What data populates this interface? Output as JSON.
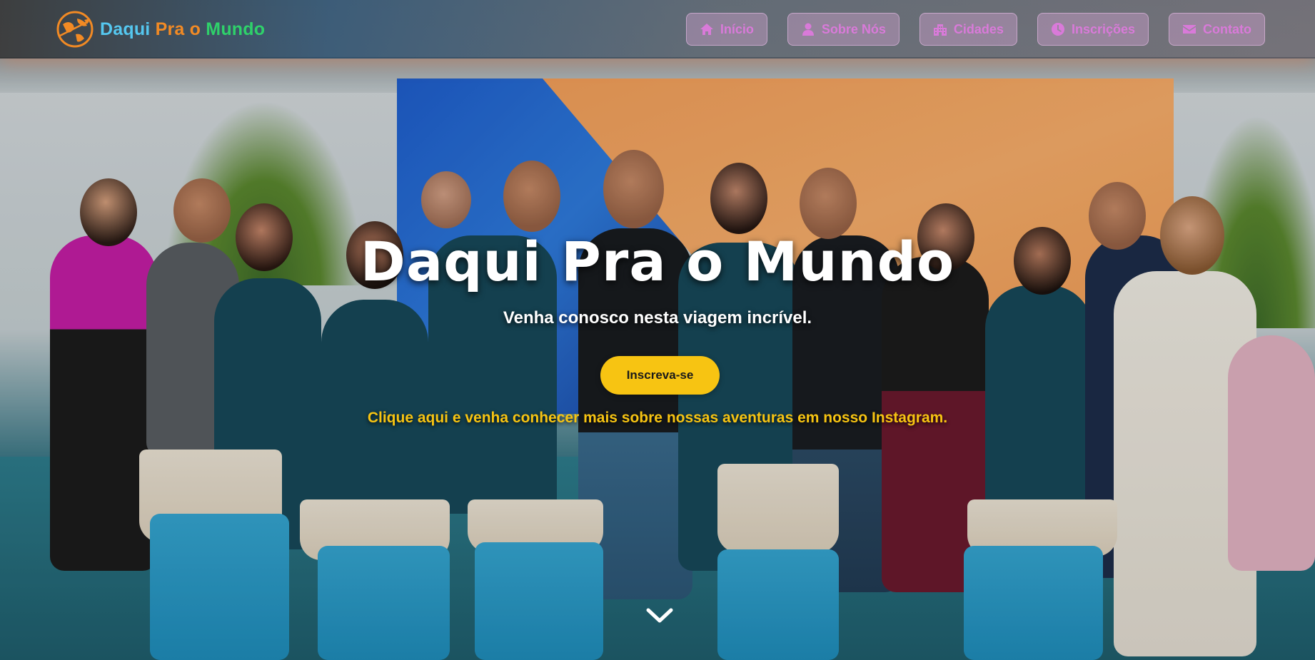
{
  "brand": {
    "part1": "Daqui",
    "part2": "Pra o",
    "part3": "Mundo",
    "logo_icon": "globe-plane-icon"
  },
  "nav": {
    "items": [
      {
        "label": "Início",
        "icon": "home-icon"
      },
      {
        "label": "Sobre Nós",
        "icon": "user-icon"
      },
      {
        "label": "Cidades",
        "icon": "city-icon"
      },
      {
        "label": "Inscrições",
        "icon": "clock-icon"
      },
      {
        "label": "Contato",
        "icon": "envelope-icon"
      }
    ]
  },
  "hero": {
    "title": "Daqui Pra o Mundo",
    "subtitle": "Venha conosco nesta viagem incrível.",
    "cta_label": "Inscreva-se",
    "instagram_text": "Clique aqui e venha conhecer mais sobre nossas aventuras em nosso Instagram.",
    "scroll_icon": "chevron-down-icon"
  },
  "colors": {
    "brand_blue": "#55c7ef",
    "brand_orange": "#f28a24",
    "brand_green": "#2fd16a",
    "nav_text": "#d97ad9",
    "cta_yellow": "#f7c412"
  }
}
